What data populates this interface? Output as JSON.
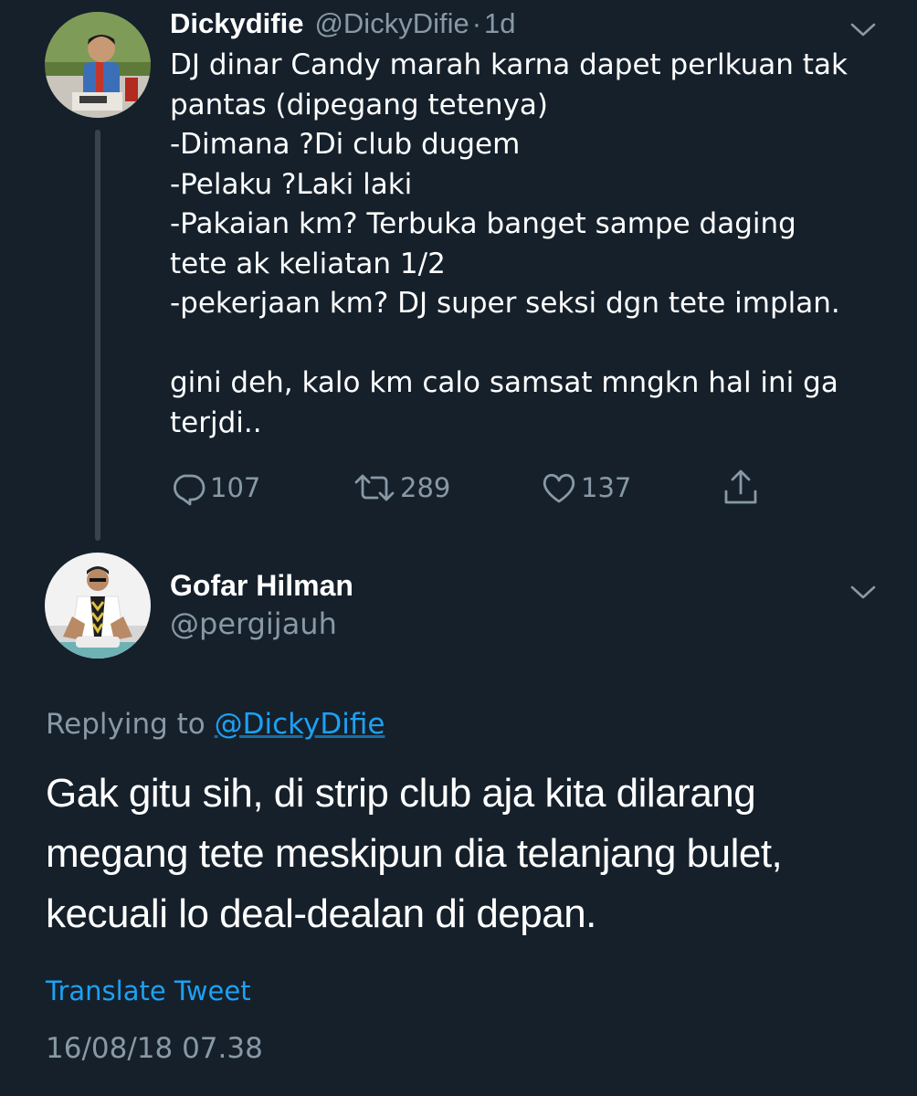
{
  "colors": {
    "background": "#15202b",
    "primary_text": "#ffffff",
    "secondary_text": "#8899a6",
    "accent": "#1da1f2",
    "thread_line": "#38444d"
  },
  "parent_tweet": {
    "display_name": "Dickydifie",
    "handle": "@DickyDifie",
    "separator": "·",
    "time_ago": "1d",
    "avatar_icon": "user-avatar-photo",
    "menu_icon": "chevron-down-icon",
    "body_lines": [
      "DJ dinar Candy marah karna dapet perlkuan tak",
      "pantas (dipegang tetenya)",
      "-Dimana ?Di club dugem",
      "-Pelaku ?Laki laki",
      "-Pakaian km? Terbuka banget sampe daging",
      "tete ak keliatan 1/2",
      "-pekerjaan km? DJ super seksi dgn tete implan.",
      "",
      "gini deh, kalo km calo samsat mngkn hal ini ga",
      "terjdi.."
    ],
    "actions": {
      "reply_count": "107",
      "retweet_count": "289",
      "like_count": "137"
    }
  },
  "reply_tweet": {
    "display_name": "Gofar Hilman",
    "handle": "@pergijauh",
    "avatar_icon": "user-avatar-photo",
    "menu_icon": "chevron-down-icon",
    "replying_prefix": "Replying to",
    "replying_to": "@DickyDifie",
    "body_lines": [
      "Gak gitu sih, di strip club aja kita dilarang",
      "megang tete meskipun dia telanjang bulet,",
      "kecuali lo deal-dealan di depan."
    ],
    "translate_label": "Translate Tweet",
    "timestamp": "16/08/18 07.38"
  }
}
